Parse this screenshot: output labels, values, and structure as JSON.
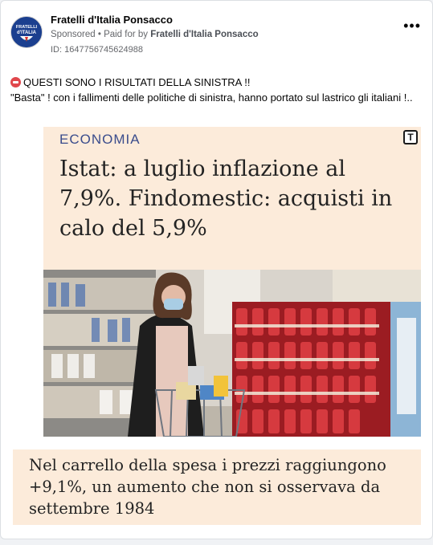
{
  "post": {
    "page_name": "Fratelli d'Italia Ponsacco",
    "sponsored_label": "Sponsored",
    "paid_for_prefix": "Paid for by",
    "paid_for_by": "Fratelli d'Italia Ponsacco",
    "ad_id": "ID: 1647756745624988",
    "more_icon": "more-options-icon",
    "avatar_text_line1": "FRATELLI",
    "avatar_text_line2": "d'ITALIA",
    "text_line1": "QUESTI SONO I RISULTATI DELLA SINISTRA !!",
    "text_line2": "\"Basta\" ! con i fallimenti delle politiche di sinistra, hanno portato sul lastrico gli italiani !..",
    "emoji_icon": "angry-face-emoji"
  },
  "creative": {
    "rubric": "ECONOMIA",
    "badge": "T",
    "headline": "Istat: a luglio inflazione al 7,9%. Findomestic: acquisti in calo del 5,9%",
    "caption": "Nel carrello della spesa i prezzi raggiungono +9,1%, un aumento che non si osservava da settembre 1984",
    "colors": {
      "panel_bg": "#fcebda",
      "rubric": "#3a4c8c",
      "headline": "#232323"
    }
  }
}
